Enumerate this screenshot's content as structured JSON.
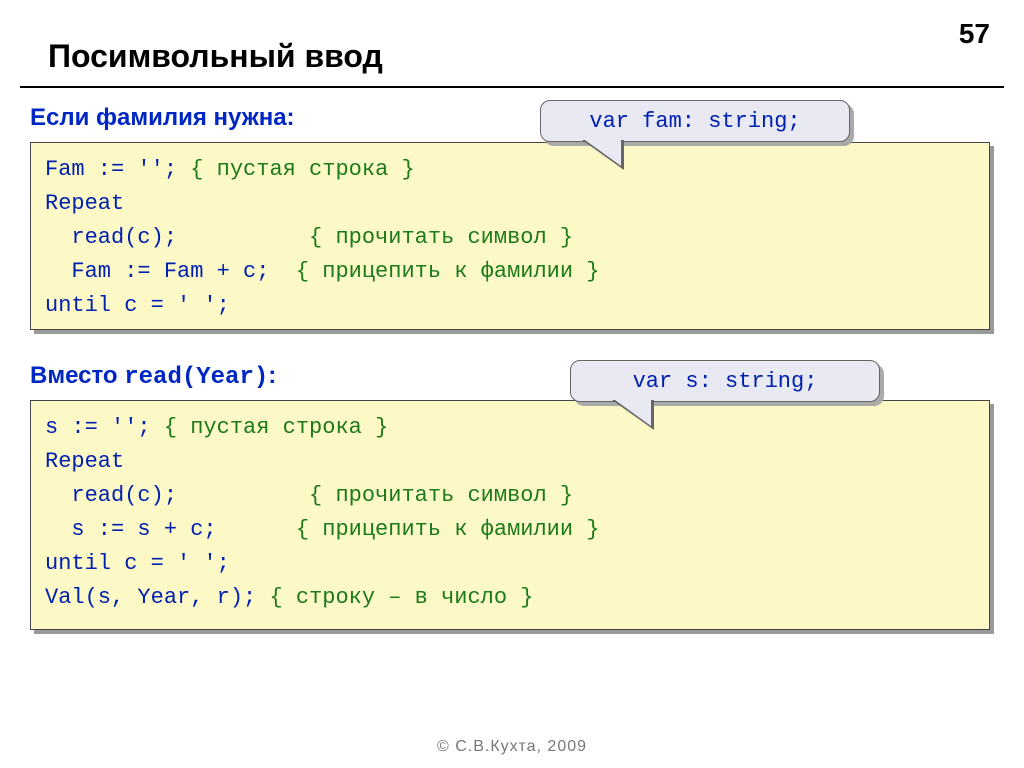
{
  "page_number": "57",
  "title": "Посимвольный ввод",
  "section1": {
    "heading": "Если фамилия нужна:",
    "callout": "var fam: string;",
    "code": {
      "l1a": "Fam := '';   ",
      "l1c": "{ пустая строка }",
      "l2": "Repeat",
      "l3a": "  read(c);          ",
      "l3c": "{ прочитать символ }",
      "l4a": "  Fam := Fam + c;  ",
      "l4c": "{ прицепить к фамилии }",
      "l5": "until c = ' ';"
    }
  },
  "section2": {
    "heading_prefix": "Вместо ",
    "heading_mono": "read(Year)",
    "heading_suffix": ":",
    "callout": "var s: string;",
    "code": {
      "l1a": "s := '';   ",
      "l1c": "{ пустая строка }",
      "l2": "Repeat",
      "l3a": "  read(c);          ",
      "l3c": "{ прочитать символ }",
      "l4a": "  s := s + c;      ",
      "l4c": "{ прицепить к фамилии }",
      "l5": "until c = ' ';",
      "l6a": "Val(s, Year, r); ",
      "l6c": "{ строку – в число }"
    }
  },
  "footer": "© С.В.Кухта, 2009"
}
